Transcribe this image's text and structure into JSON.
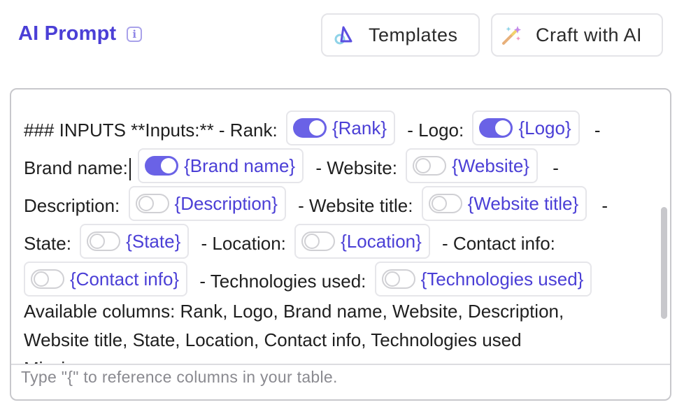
{
  "header": {
    "title": "AI Prompt",
    "info_icon": "info-icon"
  },
  "toolbar": {
    "templates_label": "Templates",
    "templates_icon": "templates-icon",
    "craft_label": "Craft with AI",
    "craft_icon": "magic-wand-icon"
  },
  "colors": {
    "accent": "#4b3fd6",
    "toggle_on": "#6a62e6",
    "border": "#c8c8cc"
  },
  "editor": {
    "text": {
      "l1_a": "### INPUTS **Inputs:** - Rank:",
      "l1_b": "- Logo:",
      "l1_c": "-",
      "l2_a": "Brand name:",
      "l2_b": "- Website:",
      "l2_c": "-",
      "l3_a": "Description:",
      "l3_b": "- Website title:",
      "l3_c": "-",
      "l4_a": "State:",
      "l4_b": "- Location:",
      "l4_c": "- Contact info:",
      "l5_a": "- Technologies used:",
      "l6": "Available columns: Rank, Logo, Brand name, Website, Description,",
      "l7": "Website title, State, Location, Contact info, Technologies used",
      "l8": "Mission"
    },
    "chips": {
      "rank": {
        "label": "{Rank}",
        "enabled": true
      },
      "logo": {
        "label": "{Logo}",
        "enabled": true
      },
      "brand_name": {
        "label": "{Brand name}",
        "enabled": true
      },
      "website": {
        "label": "{Website}",
        "enabled": false
      },
      "description": {
        "label": "{Description}",
        "enabled": false
      },
      "website_title": {
        "label": "{Website title}",
        "enabled": false
      },
      "state": {
        "label": "{State}",
        "enabled": false
      },
      "location": {
        "label": "{Location}",
        "enabled": false
      },
      "contact_info": {
        "label": "{Contact info}",
        "enabled": false
      },
      "technologies_used": {
        "label": "{Technologies used}",
        "enabled": false
      }
    },
    "placeholder": "Type \"{\" to reference columns in your table."
  }
}
